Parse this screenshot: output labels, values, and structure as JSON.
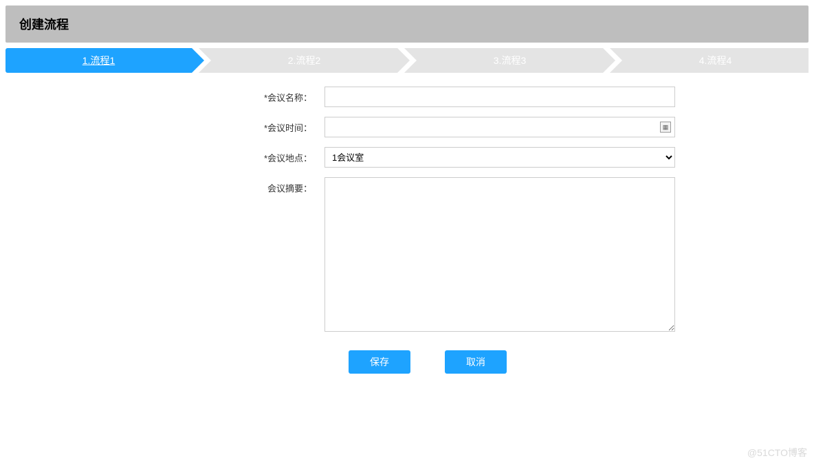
{
  "header": {
    "title": "创建流程"
  },
  "steps": [
    {
      "label": "1.流程1",
      "active": true
    },
    {
      "label": "2.流程2",
      "active": false
    },
    {
      "label": "3.流程3",
      "active": false
    },
    {
      "label": "4.流程4",
      "active": false
    }
  ],
  "form": {
    "name_label": "*会议名称：",
    "name_value": "",
    "time_label": "*会议时间：",
    "time_value": "",
    "location_label": "*会议地点：",
    "location_value": "1会议室",
    "summary_label": "会议摘要：",
    "summary_value": ""
  },
  "buttons": {
    "save": "保存",
    "cancel": "取消"
  },
  "watermark": "@51CTO博客"
}
